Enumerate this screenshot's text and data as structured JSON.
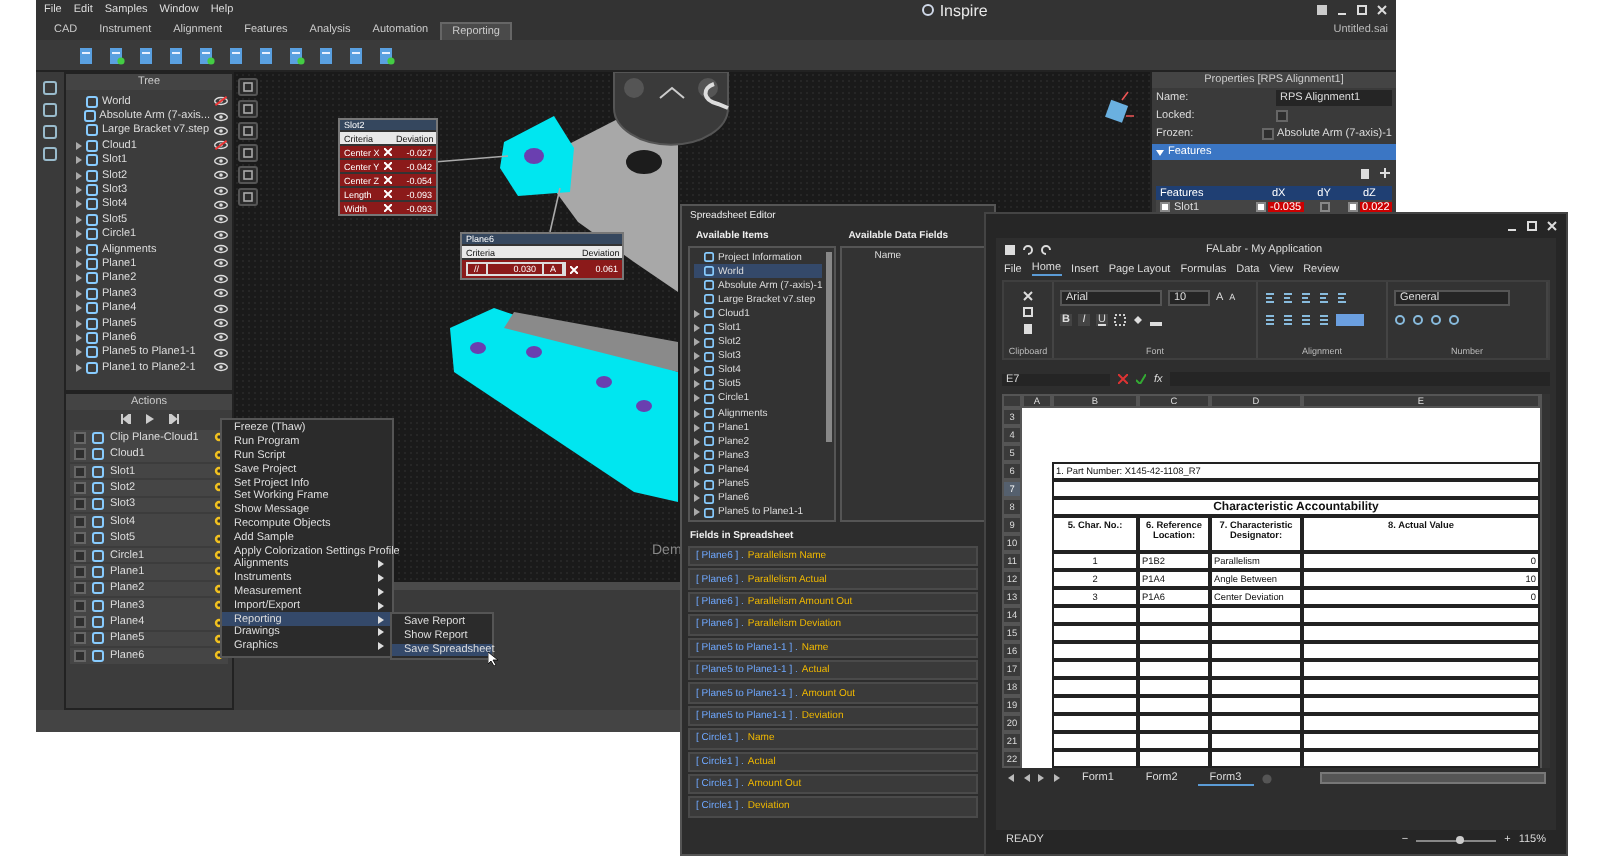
{
  "inspire": {
    "menu": [
      "File",
      "Edit",
      "Samples",
      "Window",
      "Help"
    ],
    "title": "Inspire",
    "document": "Untitled.sai",
    "ribbon_tabs": [
      {
        "label": "CAD",
        "selected": false
      },
      {
        "label": "Instrument",
        "selected": false
      },
      {
        "label": "Alignment",
        "selected": false
      },
      {
        "label": "Features",
        "selected": false
      },
      {
        "label": "Analysis",
        "selected": false
      },
      {
        "label": "Automation",
        "selected": false
      },
      {
        "label": "Reporting",
        "selected": true
      }
    ],
    "tree": {
      "title": "Tree",
      "items": [
        {
          "label": "World",
          "visible": false
        },
        {
          "label": "Absolute Arm (7-axis...",
          "visible": true
        },
        {
          "label": "Large Bracket v7.step",
          "visible": true
        },
        {
          "label": "Cloud1",
          "visible": false,
          "expanded": false
        },
        {
          "label": "Slot1",
          "visible": true,
          "expanded": false
        },
        {
          "label": "Slot2",
          "visible": true,
          "expanded": false
        },
        {
          "label": "Slot3",
          "visible": true,
          "expanded": false
        },
        {
          "label": "Slot4",
          "visible": true,
          "expanded": false
        },
        {
          "label": "Slot5",
          "visible": true,
          "expanded": false
        },
        {
          "label": "Circle1",
          "visible": true,
          "expanded": false
        },
        {
          "label": "Alignments",
          "visible": true,
          "expanded": false
        },
        {
          "label": "Plane1",
          "visible": true,
          "expanded": false
        },
        {
          "label": "Plane2",
          "visible": true,
          "expanded": false
        },
        {
          "label": "Plane3",
          "visible": true,
          "expanded": false
        },
        {
          "label": "Plane4",
          "visible": true,
          "expanded": false
        },
        {
          "label": "Plane5",
          "visible": true,
          "expanded": false
        },
        {
          "label": "Plane6",
          "visible": true,
          "expanded": false
        },
        {
          "label": "Plane5 to Plane1-1",
          "visible": true,
          "expanded": false
        },
        {
          "label": "Plane1 to Plane2-1",
          "visible": true,
          "expanded": false
        }
      ]
    },
    "viewport": {
      "callouts": [
        {
          "title": "Slot2",
          "columns": [
            "Criteria",
            "Deviation"
          ],
          "rows": [
            {
              "criterion": "Center X",
              "deviation": "-0.027"
            },
            {
              "criterion": "Center Y",
              "deviation": "-0.042"
            },
            {
              "criterion": "Center Z",
              "deviation": "-0.054"
            },
            {
              "criterion": "Length",
              "deviation": "-0.093"
            },
            {
              "criterion": "Width",
              "deviation": "-0.093"
            }
          ]
        },
        {
          "title": "Plane6",
          "columns": [
            "Criteria",
            "Deviation"
          ],
          "frame": [
            "//",
            "0.030",
            "A"
          ],
          "deviation": "0.061"
        }
      ],
      "overlay_text": "Dem"
    },
    "properties": {
      "title": "Properties [RPS Alignment1]",
      "name_label": "Name:",
      "name_value": "RPS Alignment1",
      "locked_label": "Locked:",
      "locked": false,
      "frozen_label": "Frozen:",
      "frozen": false,
      "frozen_value": "Absolute Arm (7-axis)-1",
      "section": {
        "label": "Features",
        "expanded": true
      },
      "columns": [
        "Features",
        "dX",
        "dY",
        "dZ"
      ],
      "rows": [
        {
          "label": "Slot1",
          "checked": true,
          "dx": {
            "checked": true,
            "value": "-0.035"
          },
          "dy": {
            "checked": false
          },
          "dz": {
            "checked": true,
            "value": "0.022"
          }
        }
      ]
    },
    "actions": {
      "title": "Actions",
      "items": [
        {
          "label": "Clip Plane-Cloud1",
          "checked": false
        },
        {
          "label": "Cloud1",
          "checked": false
        },
        {
          "label": "Slot1",
          "checked": false
        },
        {
          "label": "Slot2",
          "checked": false
        },
        {
          "label": "Slot3",
          "checked": false
        },
        {
          "label": "Slot4",
          "checked": false
        },
        {
          "label": "Slot5",
          "checked": false
        },
        {
          "label": "Circle1",
          "checked": false
        },
        {
          "label": "Plane1",
          "checked": false
        },
        {
          "label": "Plane2",
          "checked": false
        },
        {
          "label": "Plane3",
          "checked": false
        },
        {
          "label": "Plane4",
          "checked": false
        },
        {
          "label": "Plane5",
          "checked": false
        },
        {
          "label": "Plane6",
          "checked": false
        }
      ]
    },
    "context_menu": [
      {
        "label": "Freeze (Thaw)",
        "submenu": false,
        "selected": false
      },
      {
        "label": "Run Program",
        "submenu": false,
        "selected": false
      },
      {
        "label": "Run Script",
        "submenu": false,
        "selected": false
      },
      {
        "label": "Save Project",
        "submenu": false,
        "selected": false
      },
      {
        "label": "Set Project Info",
        "submenu": false,
        "selected": false
      },
      {
        "label": "Set Working Frame",
        "submenu": false,
        "selected": false
      },
      {
        "label": "Show Message",
        "submenu": false,
        "selected": false
      },
      {
        "label": "Recompute Objects",
        "submenu": false,
        "selected": false
      },
      {
        "label": "Add Sample",
        "submenu": false,
        "selected": false
      },
      {
        "label": "Apply Colorization Settings Profile",
        "submenu": false,
        "selected": false
      },
      {
        "label": "Alignments",
        "submenu": true,
        "selected": false
      },
      {
        "label": "Instruments",
        "submenu": true,
        "selected": false
      },
      {
        "label": "Measurement",
        "submenu": true,
        "selected": false
      },
      {
        "label": "Import/Export",
        "submenu": true,
        "selected": false
      },
      {
        "label": "Reporting",
        "submenu": true,
        "selected": true
      },
      {
        "label": "Drawings",
        "submenu": true,
        "selected": false
      },
      {
        "label": "Graphics",
        "submenu": true,
        "selected": false
      }
    ],
    "submenu": [
      {
        "label": "Save Report",
        "selected": false
      },
      {
        "label": "Show Report",
        "selected": false
      },
      {
        "label": "Save Spreadsheet",
        "selected": true
      }
    ]
  },
  "spreadsheet_editor": {
    "title": "Spreadsheet Editor",
    "items_label": "Available Items",
    "fields_label": "Available Data Fields",
    "items": [
      {
        "label": "Project Information",
        "selected": false
      },
      {
        "label": "World",
        "selected": true
      },
      {
        "label": "Absolute Arm (7-axis)-1",
        "selected": false
      },
      {
        "label": "Large Bracket v7.step",
        "selected": false
      },
      {
        "label": "Cloud1",
        "selected": false,
        "expanded": false
      },
      {
        "label": "Slot1",
        "selected": false,
        "expanded": false
      },
      {
        "label": "Slot2",
        "selected": false,
        "expanded": false
      },
      {
        "label": "Slot3",
        "selected": false,
        "expanded": false
      },
      {
        "label": "Slot4",
        "selected": false,
        "expanded": false
      },
      {
        "label": "Slot5",
        "selected": false,
        "expanded": false
      },
      {
        "label": "Circle1",
        "selected": false,
        "expanded": false
      },
      {
        "label": "Alignments",
        "selected": false,
        "expanded": false
      },
      {
        "label": "Plane1",
        "selected": false,
        "expanded": false
      },
      {
        "label": "Plane2",
        "selected": false,
        "expanded": false
      },
      {
        "label": "Plane3",
        "selected": false,
        "expanded": false
      },
      {
        "label": "Plane4",
        "selected": false,
        "expanded": false
      },
      {
        "label": "Plane5",
        "selected": false,
        "expanded": false
      },
      {
        "label": "Plane6",
        "selected": false,
        "expanded": false
      },
      {
        "label": "Plane5 to Plane1-1",
        "selected": false,
        "expanded": false
      }
    ],
    "data_fields": [
      "Name"
    ],
    "spreadsheet_label": "Fields in Spreadsheet",
    "spreadsheet_fields": [
      {
        "object": "[ Plane6 ] .",
        "field": "Parallelism Name"
      },
      {
        "object": "[ Plane6 ] .",
        "field": "Parallelism Actual"
      },
      {
        "object": "[ Plane6 ] .",
        "field": "Parallelism Amount Out"
      },
      {
        "object": "[ Plane6 ] .",
        "field": "Parallelism Deviation"
      },
      {
        "object": "[ Plane5 to Plane1-1 ] .",
        "field": "Name"
      },
      {
        "object": "[ Plane5 to Plane1-1 ] .",
        "field": "Actual"
      },
      {
        "object": "[ Plane5 to Plane1-1 ] .",
        "field": "Amount Out"
      },
      {
        "object": "[ Plane5 to Plane1-1 ] .",
        "field": "Deviation"
      },
      {
        "object": "[ Circle1 ] .",
        "field": "Name"
      },
      {
        "object": "[ Circle1 ] .",
        "field": "Actual"
      },
      {
        "object": "[ Circle1 ] .",
        "field": "Amount Out"
      },
      {
        "object": "[ Circle1 ] .",
        "field": "Deviation"
      }
    ]
  },
  "excel": {
    "title": "FALabr - My Application",
    "tabs": [
      {
        "label": "File",
        "selected": false
      },
      {
        "label": "Home",
        "selected": true
      },
      {
        "label": "Insert",
        "selected": false
      },
      {
        "label": "Page Layout",
        "selected": false
      },
      {
        "label": "Formulas",
        "selected": false
      },
      {
        "label": "Data",
        "selected": false
      },
      {
        "label": "View",
        "selected": false
      },
      {
        "label": "Review",
        "selected": false
      }
    ],
    "font": "Arial",
    "font_size": "10",
    "size_buttons": [
      "A",
      "A"
    ],
    "style_buttons": [
      "B",
      "I",
      "U"
    ],
    "number_format": "General",
    "groups": [
      "Clipboard",
      "Font",
      "Alignment",
      "Number"
    ],
    "name_box": "E7",
    "formula_label": "fx",
    "columns": [
      "A",
      "B",
      "C",
      "D",
      "E"
    ],
    "rows": [
      {
        "label": "3",
        "selected": false
      },
      {
        "label": "4",
        "selected": false
      },
      {
        "label": "5",
        "selected": false
      },
      {
        "label": "6",
        "selected": false
      },
      {
        "label": "7",
        "selected": true
      },
      {
        "label": "8",
        "selected": false
      },
      {
        "label": "9",
        "selected": false
      },
      {
        "label": "10",
        "selected": false
      },
      {
        "label": "11",
        "selected": false
      },
      {
        "label": "12",
        "selected": false
      },
      {
        "label": "13",
        "selected": false
      },
      {
        "label": "14",
        "selected": false
      },
      {
        "label": "15",
        "selected": false
      },
      {
        "label": "16",
        "selected": false
      },
      {
        "label": "17",
        "selected": false
      },
      {
        "label": "18",
        "selected": false
      },
      {
        "label": "19",
        "selected": false
      },
      {
        "label": "20",
        "selected": false
      },
      {
        "label": "21",
        "selected": false
      },
      {
        "label": "22",
        "selected": false
      }
    ],
    "part_number": "1. Part Number: X145-42-1108_R7",
    "heading": "Characteristic Accountability",
    "headers": [
      "5. Char. No.:",
      "6. Reference Location:",
      "7. Characteristic Designator:",
      "8. Actual Value"
    ],
    "data": [
      [
        "1",
        "P1B2",
        "Parallelism",
        "0"
      ],
      [
        "2",
        "P1A4",
        "Angle Between",
        "10"
      ],
      [
        "3",
        "P1A6",
        "Center Deviation",
        "0"
      ]
    ],
    "sheets": [
      {
        "label": "Form1",
        "selected": false
      },
      {
        "label": "Form2",
        "selected": false
      },
      {
        "label": "Form3",
        "selected": true
      }
    ],
    "status": "READY",
    "zoom_out": "−",
    "zoom_in": "+",
    "zoom": {
      "level": 0.55
    },
    "zoom_text": "115%"
  }
}
